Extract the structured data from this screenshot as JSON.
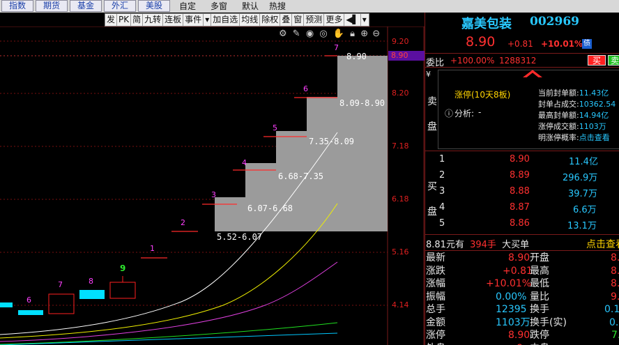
{
  "topbar": {
    "tabs": [
      "指数",
      "期货",
      "基金",
      "外汇",
      "美股"
    ],
    "links": [
      "自定",
      "多窗",
      "默认",
      "热搜"
    ]
  },
  "toolbar": {
    "items": [
      "发",
      "PK",
      "简",
      "九转",
      "连板",
      "事件",
      "▾",
      "加自选",
      "均线",
      "除权",
      "叠",
      "窗",
      "预测",
      "更多",
      "◀▌",
      "▾"
    ]
  },
  "chart": {
    "price_axis": [
      "9.20",
      "8.90",
      "8.20",
      "7.18",
      "6.18",
      "5.16",
      "4.14"
    ],
    "current_price_tag": "8.90",
    "step_numbers": [
      "1",
      "2",
      "3",
      "4",
      "5",
      "6",
      "7"
    ],
    "ranges": [
      "5.52-6.07",
      "6.07-6.68",
      "6.68-7.35",
      "7.35-8.09",
      "8.09-8.90",
      "8.90"
    ],
    "candle_labels": [
      "6",
      "7",
      "8",
      "9"
    ],
    "icons": [
      "gear-icon",
      "pen-icon",
      "eye-icon",
      "eye-alt-icon",
      "hand-icon",
      "lock-icon",
      "plus-circle-icon",
      "minus-circle-icon"
    ],
    "colors": {
      "up": "#e02020",
      "down": "#00e0ff",
      "ma_white": "#ffffff",
      "ma_yellow": "#f0f000",
      "ma_magenta": "#e040e0",
      "ma_green": "#20e020"
    }
  },
  "stock": {
    "name": "嘉美包装",
    "code": "002969",
    "price": "8.90",
    "change": "+0.81",
    "pct": "+10.01%",
    "badge": "债",
    "weibi_label": "委比",
    "weibi_value": "+100.00%",
    "weibi_diff": "1288312",
    "buy_btn": "买",
    "sell_btn": "卖",
    "sell_side_label": "卖盘",
    "yen": "¥",
    "limit_up_status": "涨停(10天8板)",
    "analysis_label": "分析:",
    "analysis_value": "-",
    "seal_info": [
      {
        "label": "当前封单额:",
        "value": "11.43亿"
      },
      {
        "label": "封单占成交:",
        "value": "10362.54"
      },
      {
        "label": "最高封单额:",
        "value": "14.94亿"
      },
      {
        "label": "涨停成交额:",
        "value": "1103万"
      },
      {
        "label": "明涨停概率:",
        "value": "点击查看"
      }
    ],
    "buy_side_label": "买盘",
    "bids": [
      {
        "level": "1",
        "price": "8.90",
        "vol": "11.4亿"
      },
      {
        "level": "2",
        "price": "8.89",
        "vol": "296.9万"
      },
      {
        "level": "3",
        "price": "8.88",
        "vol": "39.7万"
      },
      {
        "level": "4",
        "price": "8.87",
        "vol": "6.6万"
      },
      {
        "level": "5",
        "price": "8.86",
        "vol": "13.1万"
      }
    ],
    "big_order": {
      "price": "8.81",
      "unit": "元有",
      "qty": "394手",
      "label": "大买单",
      "link": "点击查看"
    },
    "quote_left": [
      {
        "label": "最新",
        "value": "8.90"
      },
      {
        "label": "涨跌",
        "value": "+0.81"
      },
      {
        "label": "涨幅",
        "value": "+10.01%"
      },
      {
        "label": "振幅",
        "value": "0.00%"
      },
      {
        "label": "总手",
        "value": "12395"
      },
      {
        "label": "金额",
        "value": "1103万"
      },
      {
        "label": "涨停",
        "value": "8.90"
      },
      {
        "label": "外盘",
        "value": "8"
      }
    ],
    "quote_right": [
      {
        "label": "开盘",
        "value": "8."
      },
      {
        "label": "最高",
        "value": "8."
      },
      {
        "label": "最低",
        "value": "8."
      },
      {
        "label": "量比",
        "value": "9."
      },
      {
        "label": "换手",
        "value": "0.13"
      },
      {
        "label": "换手(实)",
        "value": "0.3"
      },
      {
        "label": "跌停",
        "value": "7."
      },
      {
        "label": "内盘",
        "value": ""
      }
    ]
  }
}
